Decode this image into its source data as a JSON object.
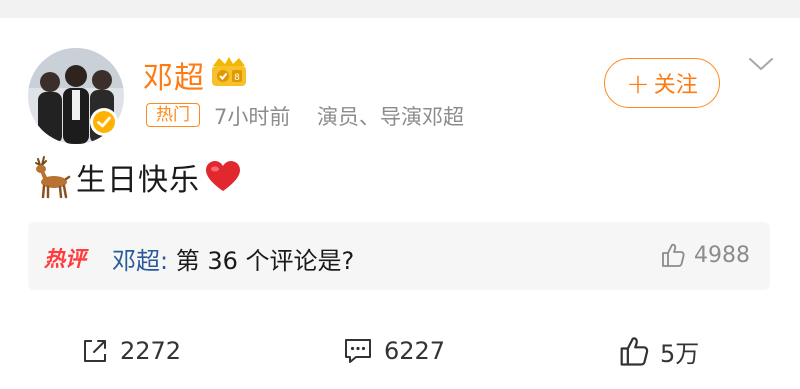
{
  "user": {
    "name": "邓超",
    "tag": "热门",
    "time": "7小时前",
    "bio": "演员、导演邓超"
  },
  "follow_button": {
    "plus": "+",
    "label": "关注"
  },
  "post": {
    "text": "生日快乐"
  },
  "hot_comment": {
    "tag": "热评",
    "user": "邓超:",
    "text": "第 36 个评论是?",
    "likes": "4988"
  },
  "actions": {
    "share": "2272",
    "comment": "6227",
    "like": "5万"
  },
  "colors": {
    "accent": "#ff7a12",
    "hot_red": "#ff3b3b",
    "link_blue": "#2b5a9b",
    "muted": "#8c8c8c"
  },
  "icons": [
    "avatar",
    "verified-badge-icon",
    "vip-badge-icon",
    "chevron-down-icon",
    "deer-emoji-icon",
    "heart-emoji-icon",
    "thumb-up-icon",
    "share-icon",
    "comment-icon"
  ]
}
